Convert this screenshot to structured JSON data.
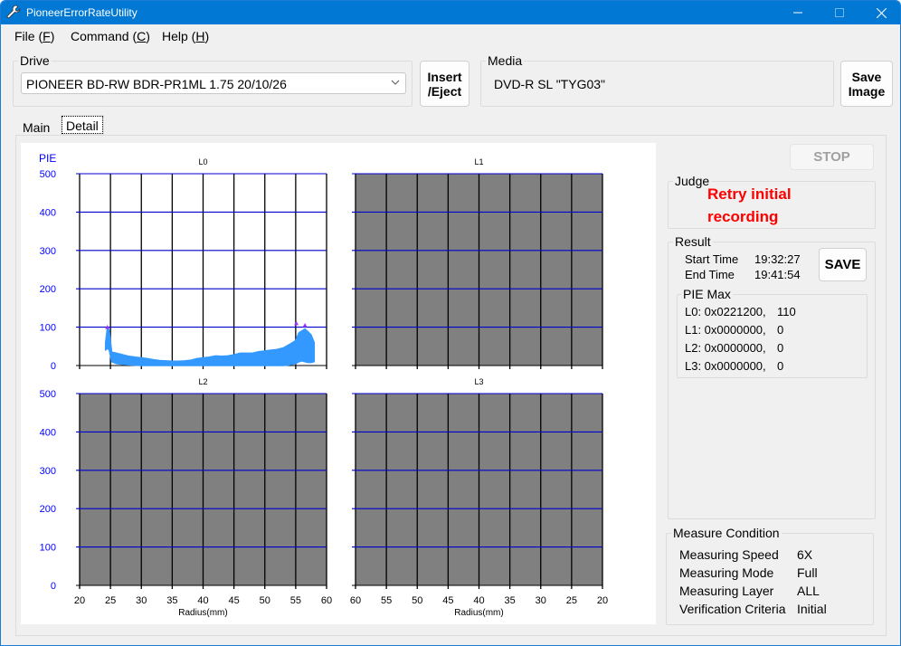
{
  "window": {
    "title": "PioneerErrorRateUtility",
    "app_icon": "wrench-icon",
    "controls": {
      "minimize": "—",
      "maximize": "☐",
      "close": "✕"
    }
  },
  "menu": [
    {
      "label": "File (",
      "key": "F",
      "suffix": ")"
    },
    {
      "label": "Command (",
      "key": "C",
      "suffix": ")"
    },
    {
      "label": "Help (",
      "key": "H",
      "suffix": ")"
    }
  ],
  "drive": {
    "legend": "Drive",
    "selected": "PIONEER BD-RW BDR-PR1ML 1.75 20/10/26",
    "insert_eject_label_1": "Insert",
    "insert_eject_label_2": "/Eject"
  },
  "media": {
    "legend": "Media",
    "value": "DVD-R SL \"TYG03\"",
    "save_image_label_1": "Save",
    "save_image_label_2": "Image"
  },
  "tabs": [
    {
      "label": "Main",
      "active": false
    },
    {
      "label": "Detail",
      "active": true
    }
  ],
  "controls": {
    "stop_label": "STOP",
    "save_label": "SAVE"
  },
  "judge": {
    "legend": "Judge",
    "line1": "Retry initial",
    "line2": "recording",
    "color": "#ff0000"
  },
  "result": {
    "legend": "Result",
    "start_time_label": "Start Time",
    "start_time": "19:32:27",
    "end_time_label": "End Time",
    "end_time": "19:41:54",
    "pie_max_legend": "PIE Max",
    "pie_max": [
      {
        "label": "L0: 0x0221200,",
        "value": "110"
      },
      {
        "label": "L1: 0x0000000,",
        "value": "0"
      },
      {
        "label": "L2: 0x0000000,",
        "value": "0"
      },
      {
        "label": "L3: 0x0000000,",
        "value": "0"
      }
    ]
  },
  "measure_condition": {
    "legend": "Measure Condition",
    "rows": [
      {
        "label": "Measuring Speed",
        "value": "6X"
      },
      {
        "label": "Measuring Mode",
        "value": "Full"
      },
      {
        "label": "Measuring Layer",
        "value": "ALL"
      },
      {
        "label": "Verification Criteria",
        "value": "Initial"
      }
    ]
  },
  "chart_data": [
    {
      "type": "area",
      "title": "L0",
      "ylabel": "PIE",
      "xlabel": "",
      "xlim": [
        20,
        60
      ],
      "ylim": [
        0,
        500
      ],
      "x_ticks": [
        20,
        25,
        30,
        35,
        40,
        45,
        50,
        55,
        60
      ],
      "y_ticks": [
        0,
        100,
        200,
        300,
        400,
        500
      ],
      "grid": true,
      "active": true,
      "series": [
        {
          "name": "PIE",
          "color": "#3399ff",
          "x": [
            24.2,
            24.5,
            24.8,
            25.2,
            26,
            27,
            28,
            29,
            30,
            31,
            32,
            33,
            34,
            35,
            36,
            37,
            38,
            39,
            40,
            41,
            42,
            43,
            44,
            45,
            46,
            47,
            48,
            49,
            50,
            51,
            52,
            53,
            54,
            55,
            55.5,
            56,
            56.5,
            57,
            57.5,
            58
          ],
          "y": [
            60,
            98,
            90,
            35,
            32,
            28,
            24,
            22,
            20,
            18,
            15,
            13,
            12,
            11,
            11,
            12,
            14,
            18,
            20,
            22,
            25,
            24,
            25,
            28,
            32,
            32,
            32,
            36,
            38,
            40,
            42,
            46,
            55,
            65,
            85,
            90,
            95,
            88,
            80,
            60
          ],
          "min": [
            40,
            45,
            40,
            10,
            5,
            3,
            2,
            1,
            0,
            0,
            0,
            0,
            0,
            0,
            0,
            0,
            0,
            0,
            0,
            0,
            0,
            0,
            0,
            0,
            0,
            0,
            0,
            0,
            0,
            0,
            0,
            0,
            2,
            5,
            10,
            12,
            10,
            8,
            8,
            10
          ]
        },
        {
          "name": "PIE Max markers",
          "color": "#9933ff",
          "x": [
            24.5,
            55.1,
            56.5
          ],
          "y": [
            100,
            110,
            105
          ]
        }
      ]
    },
    {
      "type": "area",
      "title": "L1",
      "xlabel": "",
      "xlim": [
        60,
        20
      ],
      "ylim": [
        0,
        500
      ],
      "x_ticks": [
        60,
        55,
        50,
        45,
        40,
        35,
        30,
        25,
        20
      ],
      "y_ticks": [
        0,
        100,
        200,
        300,
        400,
        500
      ],
      "grid": true,
      "active": false,
      "series": []
    },
    {
      "type": "area",
      "title": "L2",
      "xlabel": "Radius(mm)",
      "xlim": [
        20,
        60
      ],
      "ylim": [
        0,
        500
      ],
      "x_ticks": [
        20,
        25,
        30,
        35,
        40,
        45,
        50,
        55,
        60
      ],
      "y_ticks": [
        0,
        100,
        200,
        300,
        400,
        500
      ],
      "grid": true,
      "active": false,
      "series": []
    },
    {
      "type": "area",
      "title": "L3",
      "xlabel": "Radius(mm)",
      "xlim": [
        60,
        20
      ],
      "ylim": [
        0,
        500
      ],
      "x_ticks": [
        60,
        55,
        50,
        45,
        40,
        35,
        30,
        25,
        20
      ],
      "y_ticks": [
        0,
        100,
        200,
        300,
        400,
        500
      ],
      "grid": true,
      "active": false,
      "series": []
    }
  ]
}
